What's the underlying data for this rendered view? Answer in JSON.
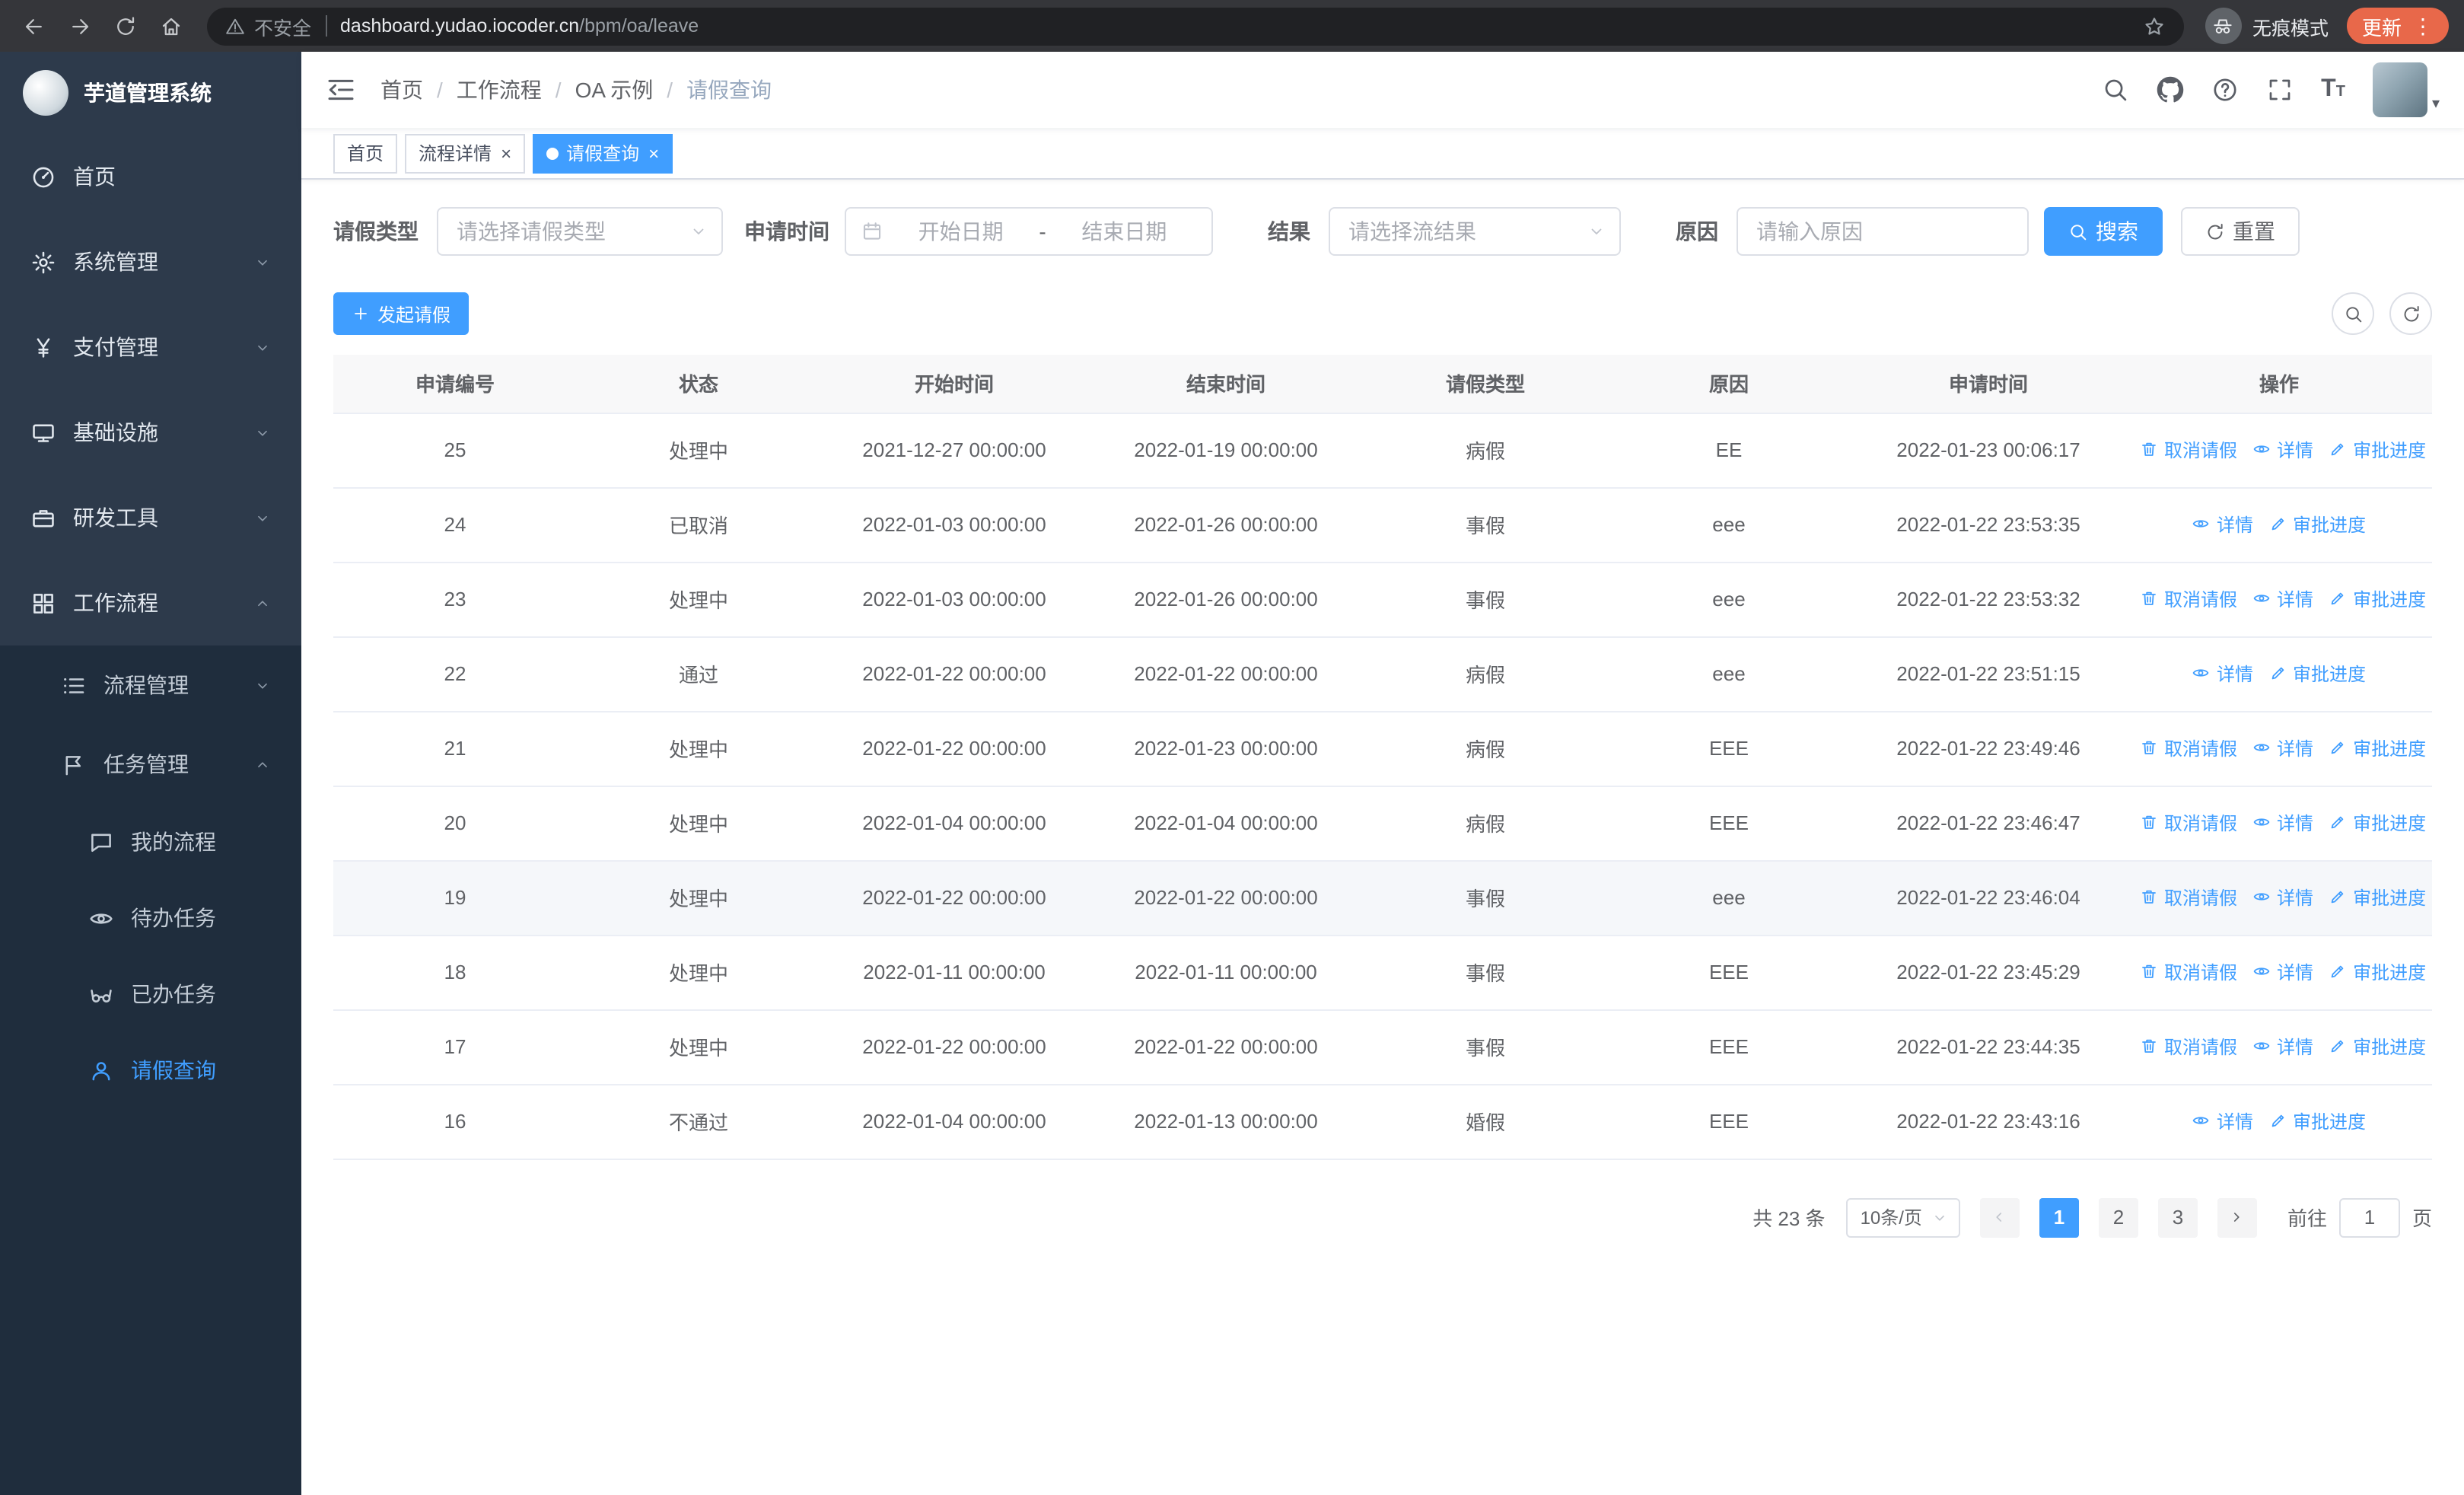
{
  "colors": {
    "accent": "#409eff",
    "sidebar_bg": "#1f2d3d",
    "sidebar_item_bg": "#2d3a4b",
    "table_header_bg": "#f8f8f9",
    "row_highlight": "#f5f7fa",
    "browser_bar_bg": "#35363a",
    "address_bar_bg": "#202124",
    "update_chip_bg": "#e8684a",
    "link_color": "#409eff"
  },
  "browser": {
    "security_label": "不安全",
    "url_domain": "dashboard.yudao.iocoder.cn",
    "url_path": "/bpm/oa/leave",
    "incognito_label": "无痕模式",
    "update_label": "更新"
  },
  "sidebar": {
    "logo_title": "芋道管理系统",
    "menu": [
      {
        "key": "home",
        "label": "首页",
        "icon": "dashboard",
        "level": 1
      },
      {
        "key": "system-management",
        "label": "系统管理",
        "icon": "gear",
        "level": 1,
        "arrow": "down"
      },
      {
        "key": "payment-management",
        "label": "支付管理",
        "icon": "yen",
        "level": 1,
        "arrow": "down"
      },
      {
        "key": "infrastructure",
        "label": "基础设施",
        "icon": "monitor",
        "level": 1,
        "arrow": "down"
      },
      {
        "key": "dev-tools",
        "label": "研发工具",
        "icon": "briefcase",
        "level": 1,
        "arrow": "down"
      },
      {
        "key": "workflow",
        "label": "工作流程",
        "icon": "modules",
        "level": 1,
        "arrow": "up"
      },
      {
        "key": "process-management",
        "label": "流程管理",
        "icon": "list",
        "level": 2,
        "arrow": "down"
      },
      {
        "key": "task-management",
        "label": "任务管理",
        "icon": "flag",
        "level": 2,
        "arrow": "up"
      },
      {
        "key": "my-process",
        "label": "我的流程",
        "icon": "chat",
        "level": 3
      },
      {
        "key": "todo-tasks",
        "label": "待办任务",
        "icon": "eye",
        "level": 3
      },
      {
        "key": "done-tasks",
        "label": "已办任务",
        "icon": "glasses",
        "level": 3
      },
      {
        "key": "leave-query",
        "label": "请假查询",
        "icon": "person",
        "level": 3,
        "active": true
      }
    ]
  },
  "header": {
    "breadcrumb_separator": "/",
    "breadcrumb": [
      {
        "key": "home",
        "label": "首页"
      },
      {
        "key": "workflow",
        "label": "工作流程"
      },
      {
        "key": "oa-example",
        "label": "OA 示例"
      },
      {
        "key": "leave-query",
        "label": "请假查询",
        "current": true
      }
    ]
  },
  "tabs": [
    {
      "key": "home",
      "label": "首页",
      "closable": false,
      "active": false
    },
    {
      "key": "process-detail",
      "label": "流程详情",
      "closable": true,
      "active": false
    },
    {
      "key": "leave-query",
      "label": "请假查询",
      "closable": true,
      "active": true
    }
  ],
  "filters": {
    "leave_type": {
      "label": "请假类型",
      "placeholder": "请选择请假类型"
    },
    "apply_time": {
      "label": "申请时间",
      "start_placeholder": "开始日期",
      "separator": "-",
      "end_placeholder": "结束日期"
    },
    "result": {
      "label": "结果",
      "placeholder": "请选择流结果"
    },
    "reason": {
      "label": "原因",
      "placeholder": "请输入原因"
    },
    "search_label": "搜索",
    "reset_label": "重置"
  },
  "toolbar": {
    "create_label": "发起请假"
  },
  "table": {
    "columns": [
      "申请编号",
      "状态",
      "开始时间",
      "结束时间",
      "请假类型",
      "原因",
      "申请时间",
      "操作"
    ],
    "column_keys": [
      "id",
      "status",
      "start-time",
      "end-time",
      "leave-type",
      "reason",
      "apply-time",
      "actions"
    ],
    "action_labels": {
      "cancel": "取消请假",
      "detail": "详情",
      "progress": "审批进度"
    },
    "rows": [
      {
        "id": "25",
        "status": "处理中",
        "start": "2021-12-27 00:00:00",
        "end": "2022-01-19 00:00:00",
        "type": "病假",
        "reason": "EE",
        "apply_time": "2022-01-23 00:06:17",
        "actions": [
          "cancel",
          "detail",
          "progress"
        ]
      },
      {
        "id": "24",
        "status": "已取消",
        "start": "2022-01-03 00:00:00",
        "end": "2022-01-26 00:00:00",
        "type": "事假",
        "reason": "eee",
        "apply_time": "2022-01-22 23:53:35",
        "actions": [
          "detail",
          "progress"
        ]
      },
      {
        "id": "23",
        "status": "处理中",
        "start": "2022-01-03 00:00:00",
        "end": "2022-01-26 00:00:00",
        "type": "事假",
        "reason": "eee",
        "apply_time": "2022-01-22 23:53:32",
        "actions": [
          "cancel",
          "detail",
          "progress"
        ]
      },
      {
        "id": "22",
        "status": "通过",
        "start": "2022-01-22 00:00:00",
        "end": "2022-01-22 00:00:00",
        "type": "病假",
        "reason": "eee",
        "apply_time": "2022-01-22 23:51:15",
        "actions": [
          "detail",
          "progress"
        ]
      },
      {
        "id": "21",
        "status": "处理中",
        "start": "2022-01-22 00:00:00",
        "end": "2022-01-23 00:00:00",
        "type": "病假",
        "reason": "EEE",
        "apply_time": "2022-01-22 23:49:46",
        "actions": [
          "cancel",
          "detail",
          "progress"
        ]
      },
      {
        "id": "20",
        "status": "处理中",
        "start": "2022-01-04 00:00:00",
        "end": "2022-01-04 00:00:00",
        "type": "病假",
        "reason": "EEE",
        "apply_time": "2022-01-22 23:46:47",
        "actions": [
          "cancel",
          "detail",
          "progress"
        ]
      },
      {
        "id": "19",
        "status": "处理中",
        "start": "2022-01-22 00:00:00",
        "end": "2022-01-22 00:00:00",
        "type": "事假",
        "reason": "eee",
        "apply_time": "2022-01-22 23:46:04",
        "actions": [
          "cancel",
          "detail",
          "progress"
        ],
        "highlighted": true
      },
      {
        "id": "18",
        "status": "处理中",
        "start": "2022-01-11 00:00:00",
        "end": "2022-01-11 00:00:00",
        "type": "事假",
        "reason": "EEE",
        "apply_time": "2022-01-22 23:45:29",
        "actions": [
          "cancel",
          "detail",
          "progress"
        ]
      },
      {
        "id": "17",
        "status": "处理中",
        "start": "2022-01-22 00:00:00",
        "end": "2022-01-22 00:00:00",
        "type": "事假",
        "reason": "EEE",
        "apply_time": "2022-01-22 23:44:35",
        "actions": [
          "cancel",
          "detail",
          "progress"
        ]
      },
      {
        "id": "16",
        "status": "不通过",
        "start": "2022-01-04 00:00:00",
        "end": "2022-01-13 00:00:00",
        "type": "婚假",
        "reason": "EEE",
        "apply_time": "2022-01-22 23:43:16",
        "actions": [
          "detail",
          "progress"
        ]
      }
    ]
  },
  "pagination": {
    "total_text": "共 23 条",
    "page_size_text": "10条/页",
    "pages": [
      "1",
      "2",
      "3"
    ],
    "active_page": "1",
    "goto_label": "前往",
    "goto_value": "1",
    "goto_unit": "页"
  }
}
